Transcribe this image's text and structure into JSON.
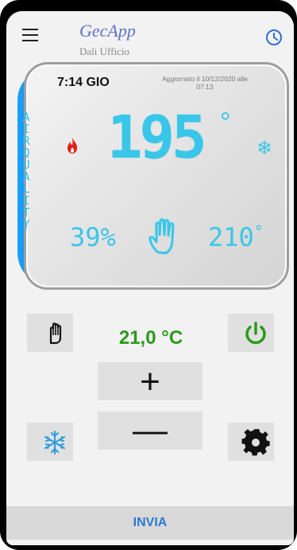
{
  "appbar": {
    "title": "GecApp",
    "subtitle": "Dali Ufficio",
    "menu_icon": "hamburger-menu-icon",
    "clock_icon": "clock-icon"
  },
  "display": {
    "time": "7:14 GIO",
    "updated": "Aggiornato il 10/12/2020 alle 07:13",
    "air_quality_label": "AIR QUALITY",
    "room_temp": "195",
    "room_temp_unit": "°",
    "humidity": "39%",
    "outdoor_temp": "210",
    "outdoor_temp_unit": "°",
    "flame_icon": "flame-icon",
    "snowflake_icon": "snowflake-icon",
    "hand_icon": "hand-icon",
    "accent_color": "#39c6e8",
    "flame_color": "#e0231a"
  },
  "controls": {
    "setpoint": "21,0 °C",
    "setpoint_color": "#2a9a1a",
    "plus_label": "+",
    "minus_label": "—",
    "manual_icon": "hand-icon",
    "power_icon": "power-icon",
    "mode_icon": "snowflake-icon",
    "settings_icon": "gear-icon"
  },
  "footer": {
    "send_label": "INVIA",
    "send_color": "#2b79d2"
  }
}
